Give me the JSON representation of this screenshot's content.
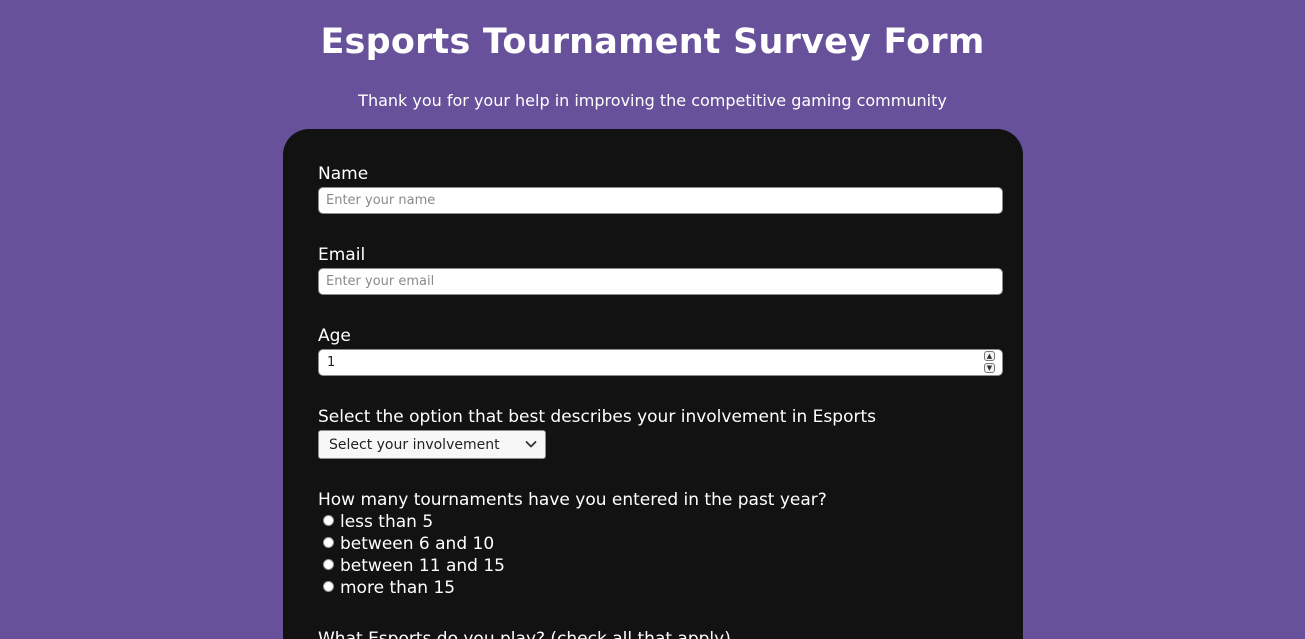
{
  "header": {
    "title": "Esports Tournament Survey Form",
    "subtitle": "Thank you for your help in improving the competitive gaming community"
  },
  "form": {
    "name": {
      "label": "Name",
      "placeholder": "Enter your name",
      "value": ""
    },
    "email": {
      "label": "Email",
      "placeholder": "Enter your email",
      "value": ""
    },
    "age": {
      "label": "Age",
      "value": "1"
    },
    "involvement": {
      "label": "Select the option that best describes your involvement in Esports",
      "selected": "Select your involvement"
    },
    "tournaments": {
      "question": "How many tournaments have you entered in the past year?",
      "options": [
        "less than 5",
        "between 6 and 10",
        "between 11 and 15",
        "more than 15"
      ]
    },
    "esports_played": {
      "question": "What Esports do you play? (check all that apply)"
    }
  },
  "colors": {
    "background": "#67519a",
    "card": "#121212"
  }
}
